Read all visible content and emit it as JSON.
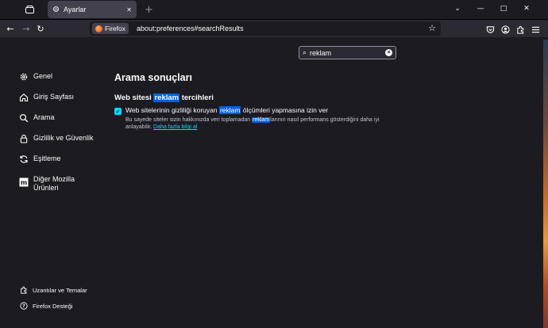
{
  "tab": {
    "title": "Ayarlar"
  },
  "window_controls": {
    "minimize": "—",
    "maximize": "□",
    "close": "✕"
  },
  "navbar": {
    "identity_label": "Firefox",
    "url": "about:preferences#searchResults"
  },
  "search": {
    "query": "reklam"
  },
  "sidebar": {
    "items": [
      {
        "label": "Genel",
        "icon": "gear-icon"
      },
      {
        "label": "Giriş Sayfası",
        "icon": "home-icon"
      },
      {
        "label": "Arama",
        "icon": "search-icon"
      },
      {
        "label": "Gizlilik ve Güvenlik",
        "icon": "lock-icon"
      },
      {
        "label": "Eşitleme",
        "icon": "sync-icon"
      },
      {
        "label_line1": "Diğer Mozilla",
        "label_line2": "Ürünleri",
        "icon": "mozilla-icon"
      }
    ],
    "bottom": [
      {
        "label": "Uzantılar ve Temalar",
        "icon": "extension-icon"
      },
      {
        "label": "Firefox Desteği",
        "icon": "help-icon"
      }
    ]
  },
  "main": {
    "title": "Arama sonuçları",
    "section": {
      "before": "Web sitesi ",
      "match": "reklam",
      "after": " tercihleri"
    },
    "checkbox": {
      "checked": true,
      "before": "Web sitelerinin gizliliği koruyan ",
      "match": "reklam",
      "after": " ölçümleri yapmasına izin ver"
    },
    "description": {
      "before": "Bu sayede siteler sizin hakkınızda veri toplamadan ",
      "match": "reklam",
      "after": "larının nasıl performans gösterdiğini daha iyi anlayabilir. ",
      "link": "Daha fazla bilgi al"
    }
  },
  "colors": {
    "background": "#1c1b22",
    "toolbar": "#2b2a33",
    "accent": "#00ddff",
    "highlight": "#0060df"
  }
}
